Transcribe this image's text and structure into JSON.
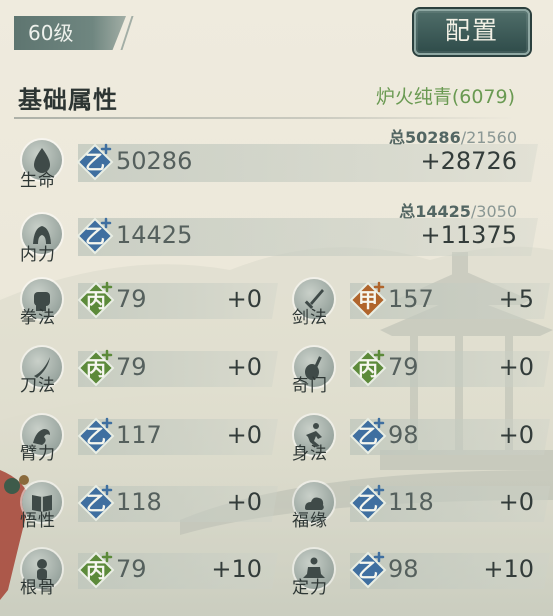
{
  "header": {
    "level": "60级",
    "config_button": "配置"
  },
  "section": {
    "title": "基础属性",
    "set_name": "炉火纯青(6079)"
  },
  "main_stats": [
    {
      "label": "生命",
      "icon": "life-drop-icon",
      "grade": "乙",
      "grade_tier": "blue",
      "base": "50286",
      "bonus": "+28726",
      "total": "总50286",
      "total_sep": "/",
      "total_cap": "21560"
    },
    {
      "label": "内力",
      "icon": "inner-power-icon",
      "grade": "乙",
      "grade_tier": "blue",
      "base": "14425",
      "bonus": "+11375",
      "total": "总14425",
      "total_sep": "/",
      "total_cap": "3050"
    }
  ],
  "skills_left": [
    {
      "label": "拳法",
      "icon": "fist-icon",
      "grade": "丙",
      "grade_tier": "green",
      "base": "79",
      "bonus": "+0"
    },
    {
      "label": "刀法",
      "icon": "blade-icon",
      "grade": "丙",
      "grade_tier": "green",
      "base": "79",
      "bonus": "+0"
    },
    {
      "label": "臂力",
      "icon": "arm-strength-icon",
      "grade": "乙",
      "grade_tier": "blue",
      "base": "117",
      "bonus": "+0"
    },
    {
      "label": "悟性",
      "icon": "book-icon",
      "grade": "乙",
      "grade_tier": "blue",
      "base": "118",
      "bonus": "+0"
    },
    {
      "label": "根骨",
      "icon": "bone-icon",
      "grade": "丙",
      "grade_tier": "green",
      "base": "79",
      "bonus": "+10"
    }
  ],
  "skills_right": [
    {
      "label": "剑法",
      "icon": "sword-icon",
      "grade": "甲",
      "grade_tier": "orange",
      "base": "157",
      "bonus": "+5"
    },
    {
      "label": "奇门",
      "icon": "pipa-icon",
      "grade": "丙",
      "grade_tier": "green",
      "base": "79",
      "bonus": "+0"
    },
    {
      "label": "身法",
      "icon": "agility-icon",
      "grade": "乙",
      "grade_tier": "blue",
      "base": "98",
      "bonus": "+0"
    },
    {
      "label": "福缘",
      "icon": "fortune-cloud-icon",
      "grade": "乙",
      "grade_tier": "blue",
      "base": "118",
      "bonus": "+0"
    },
    {
      "label": "定力",
      "icon": "meditation-icon",
      "grade": "乙",
      "grade_tier": "blue",
      "base": "98",
      "bonus": "+10"
    }
  ],
  "colors": {
    "blue": "#3f6fa0",
    "green": "#5c8a3a",
    "orange": "#b0652c",
    "set_name": "#6a9a52"
  }
}
